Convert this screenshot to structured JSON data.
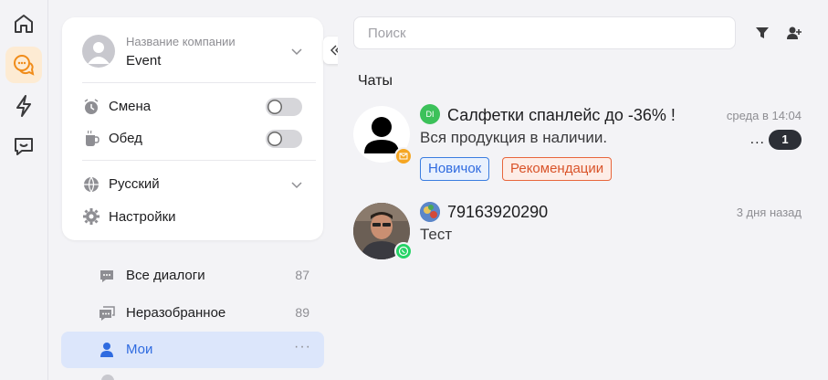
{
  "colors": {
    "accent": "#2f6be0",
    "active_rail": "#fdebd3",
    "rail_icon_active": "#f08c1a",
    "whatsapp": "#25d366",
    "source_green": "#3cc15a",
    "tag_blue": "#2f6be0",
    "tag_orange": "#d9542a",
    "unread_bg": "#2c2f36"
  },
  "rail": {
    "items": [
      {
        "icon": "home-icon"
      },
      {
        "icon": "chats-icon",
        "active": true
      },
      {
        "icon": "lightning-icon"
      },
      {
        "icon": "chat-bubble-icon"
      }
    ]
  },
  "profile": {
    "company_label": "Название компании",
    "company_name": "Event",
    "shift_label": "Смена",
    "lunch_label": "Обед",
    "language": "Русский",
    "settings_label": "Настройки"
  },
  "nav": {
    "items": [
      {
        "label": "Все диалоги",
        "count": "87",
        "icon": "all-dialogs-icon"
      },
      {
        "label": "Неразобранное",
        "count": "89",
        "icon": "unsorted-icon"
      },
      {
        "label": "Мои",
        "count": "",
        "icon": "user-icon",
        "active": true,
        "more": "···"
      }
    ]
  },
  "chats": {
    "search_placeholder": "Поиск",
    "title": "Чаты",
    "list": [
      {
        "source_initials": "DI",
        "name": "Салфетки спанлейс до -36% !",
        "time": "среда в 14:04",
        "preview": "Вся продукция в наличии.",
        "dots": "...",
        "unread": "1",
        "tags": [
          "Новичок",
          "Рекомендации"
        ],
        "channel": "email-channel-icon"
      },
      {
        "name": "79163920290",
        "time": "3 дня назад",
        "preview": "Тест",
        "channel": "whatsapp-icon"
      }
    ]
  }
}
